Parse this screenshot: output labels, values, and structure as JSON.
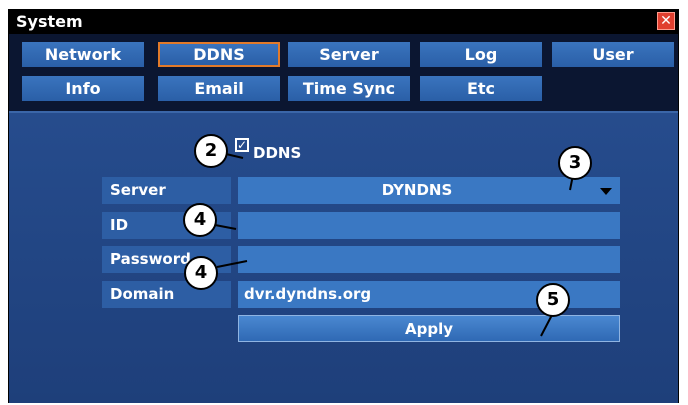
{
  "window": {
    "title": "System",
    "close_label": "✕"
  },
  "tabs": [
    {
      "label": "Network"
    },
    {
      "label": "DDNS",
      "active": true
    },
    {
      "label": "Server"
    },
    {
      "label": "Log"
    },
    {
      "label": "User"
    },
    {
      "label": "Info"
    },
    {
      "label": "Email"
    },
    {
      "label": "Time Sync"
    },
    {
      "label": "Etc"
    }
  ],
  "ddns": {
    "checkbox_label": "DDNS",
    "checked": true
  },
  "form": {
    "server_label": "Server",
    "server_value": "DYNDNS",
    "id_label": "ID",
    "id_value": "",
    "password_label": "Password",
    "password_value": "",
    "domain_label": "Domain",
    "domain_value": "dvr.dyndns.org",
    "apply_label": "Apply"
  },
  "callouts": [
    "2",
    "3",
    "4",
    "4",
    "5"
  ],
  "colors": {
    "background": "#15244a",
    "panel": "#264c8d",
    "field": "#3a78c3",
    "active_tab_border": "#e27a2a",
    "close_button": "#e03f2f"
  },
  "icons": {
    "close": "close-icon",
    "dropdown": "chevron-down-icon",
    "checkbox": "checkbox-checked-icon"
  }
}
